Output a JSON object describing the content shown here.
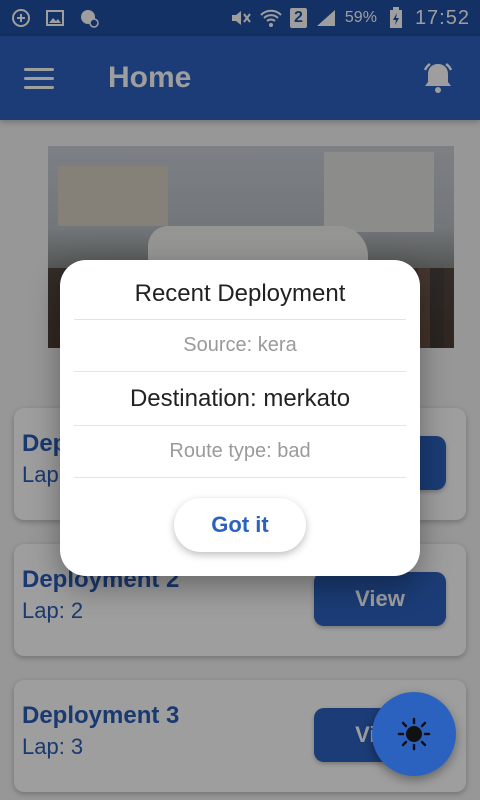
{
  "status_bar": {
    "sim_slot": "2",
    "battery": "59%",
    "time": "17:52",
    "icons": [
      "add-circle-icon",
      "image-icon",
      "location-icon",
      "mute-icon",
      "wifi-icon",
      "signal-icon",
      "battery-charging-icon"
    ]
  },
  "app_bar": {
    "title": "Home",
    "menu_icon": "menu-icon",
    "notification_icon": "bell-icon"
  },
  "cards": [
    {
      "title": "Deployment 1",
      "lap": "Lap: 1",
      "button": "View"
    },
    {
      "title": "Deployment 2",
      "lap": "Lap: 2",
      "button": "View"
    },
    {
      "title": "Deployment 3",
      "lap": "Lap: 3",
      "button": "View"
    }
  ],
  "dialog": {
    "title": "Recent Deployment",
    "source": "Source: kera",
    "destination": "Destination: merkato",
    "route_type": "Route type: bad",
    "confirm": "Got it"
  },
  "fab": {
    "icon": "brightness-icon"
  },
  "colors": {
    "primary": "#2c62bf",
    "status_bar": "#1f4fa3",
    "accent_text": "#2a5db7"
  }
}
